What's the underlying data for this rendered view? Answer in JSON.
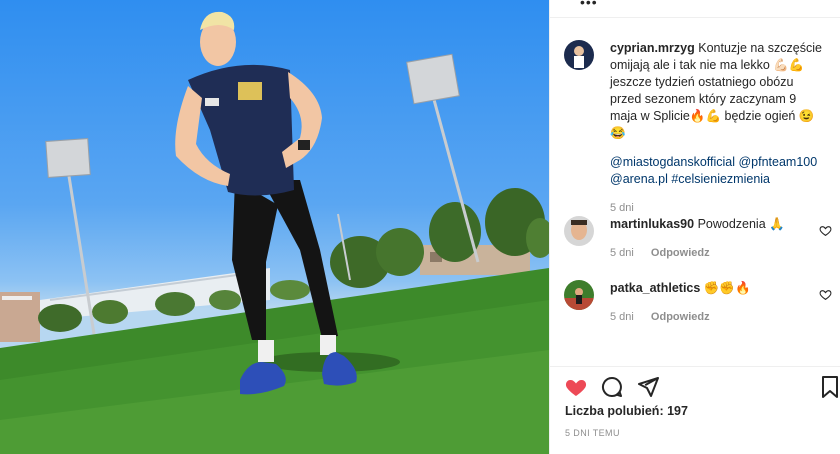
{
  "post": {
    "author": "cyprian.mrzyg",
    "caption": "Kontuzje na szczęście omijają ale i tak nie ma lekko 💪🏻💪 jeszcze tydzień ostatniego obózu przed sezonem który zaczynam 9 maja w Splicie🔥💪 będzie ogień 😉😂",
    "tags": "@miastogdanskofficial @pfnteam100 @arena.pl #celsieniezmienia",
    "age": "5 dni"
  },
  "comments": [
    {
      "user": "martinlukas90",
      "text": "Powodzenia 🙏",
      "age": "5 dni",
      "reply_label": "Odpowiedz"
    },
    {
      "user": "patka_athletics",
      "text": "✊✊🔥",
      "age": "5 dni",
      "reply_label": "Odpowiedz"
    }
  ],
  "actions": {
    "like_icon": "heart-filled-icon",
    "comment_icon": "comment-icon",
    "share_icon": "share-icon",
    "save_icon": "bookmark-icon",
    "like_color": "#ed4956"
  },
  "likes_label": "Liczba polubień: 197",
  "date_label": "5 DNI TEMU",
  "top_menu": "•••"
}
